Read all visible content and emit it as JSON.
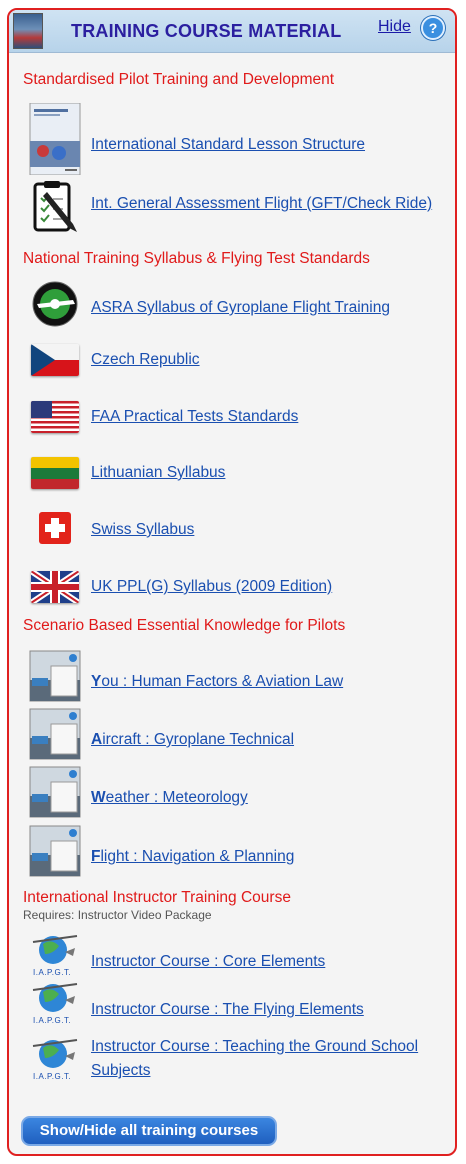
{
  "header": {
    "title": "TRAINING COURSE MATERIAL",
    "hide_label": "Hide",
    "help_icon": "help-icon"
  },
  "sections": [
    {
      "title": "Standardised Pilot Training and Development",
      "items": [
        {
          "label": "International Standard Lesson Structure",
          "icon": "handbook-cover-icon"
        },
        {
          "label": "Int. General Assessment Flight (GFT/Check Ride)",
          "icon": "clipboard-pencil-icon"
        }
      ]
    },
    {
      "title": "National Training Syllabus & Flying Test Standards",
      "items": [
        {
          "label": "ASRA Syllabus of Gyroplane Flight Training",
          "icon": "asra-logo-icon"
        },
        {
          "label": "Czech Republic",
          "icon": "czech-flag-icon"
        },
        {
          "label": "FAA Practical Tests Standards",
          "icon": "us-flag-icon"
        },
        {
          "label": "Lithuanian Syllabus",
          "icon": "lithuania-flag-icon"
        },
        {
          "label": "Swiss Syllabus",
          "icon": "swiss-flag-icon"
        },
        {
          "label": "UK PPL(G) Syllabus (2009 Edition)",
          "icon": "uk-flag-icon"
        }
      ]
    },
    {
      "title": "Scenario Based Essential Knowledge for Pilots",
      "items": [
        {
          "first": "Y",
          "rest": "ou : Human Factors & Aviation Law",
          "icon": "scenario-thumbnail-icon"
        },
        {
          "first": "A",
          "rest": "ircraft : Gyroplane Technical",
          "icon": "scenario-thumbnail-icon"
        },
        {
          "first": "W",
          "rest": "eather : Meteorology",
          "icon": "scenario-thumbnail-icon"
        },
        {
          "first": "F",
          "rest": "light : Navigation & Planning",
          "icon": "scenario-thumbnail-icon"
        }
      ]
    },
    {
      "title": "International Instructor Training Course",
      "note": "Requires: Instructor Video Package",
      "items": [
        {
          "label": "Instructor Course : Core Elements",
          "icon": "iapgt-logo-icon",
          "logo_text": "I.A.P.G.T."
        },
        {
          "label": "Instructor Course : The Flying Elements",
          "icon": "iapgt-logo-icon",
          "logo_text": "I.A.P.G.T."
        },
        {
          "label": "Instructor Course : Teaching the Ground School Subjects",
          "icon": "iapgt-logo-icon",
          "logo_text": "I.A.P.G.T."
        }
      ]
    }
  ],
  "footer": {
    "button_label": "Show/Hide all training courses"
  },
  "colors": {
    "section_title": "#e01a1a",
    "link": "#1a4fb0",
    "header_title": "#2b1fa0",
    "border": "#e02020"
  }
}
